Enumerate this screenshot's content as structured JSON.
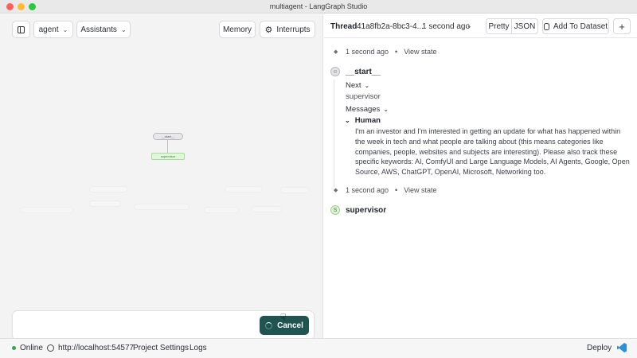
{
  "window": {
    "title": "multiagent - LangGraph Studio"
  },
  "toolbar": {
    "graph_select": "agent",
    "assistants": "Assistants",
    "memory": "Memory",
    "interrupts": "Interrupts"
  },
  "graph": {
    "start_node": "__start__",
    "supervisor_node": "supervisor"
  },
  "chat": {
    "cancel_label": "Cancel"
  },
  "thread": {
    "label": "Thread",
    "id": "41a8fb2a-8bc3-4...",
    "time": "1 second ago",
    "view_pretty": "Pretty",
    "view_json": "JSON",
    "add_to_dataset": "Add To Dataset",
    "add_icon": "+"
  },
  "timeline": {
    "step1": {
      "time": "1 second ago",
      "view_state": "View state"
    },
    "start_node": {
      "name": "__start__",
      "next_label": "Next",
      "next_value": "supervisor",
      "messages_label": "Messages",
      "role": "Human",
      "content": "I'm an investor and I'm interested in getting an update for what has happened within the week in tech and what people are talking about (this means categories like companies, people, websites and subjects are interesting). Please also track these specific keywords: AI, ComfyUI and Large Language Models, AI Agents, Google, Open Source, AWS, ChatGPT, OpenAI, Microsoft, Networking too."
    },
    "step2": {
      "time": "1 second ago",
      "view_state": "View state"
    },
    "supervisor_node": {
      "name": "supervisor",
      "avatar": "S"
    }
  },
  "statusbar": {
    "status": "Online",
    "url": "http://localhost:54577",
    "project_settings": "Project Settings",
    "logs": "Logs",
    "deploy": "Deploy"
  },
  "colors": {
    "accent": "#1f5450",
    "online": "#2fa84f",
    "supervisor_node_fill": "#e2f6dc"
  }
}
